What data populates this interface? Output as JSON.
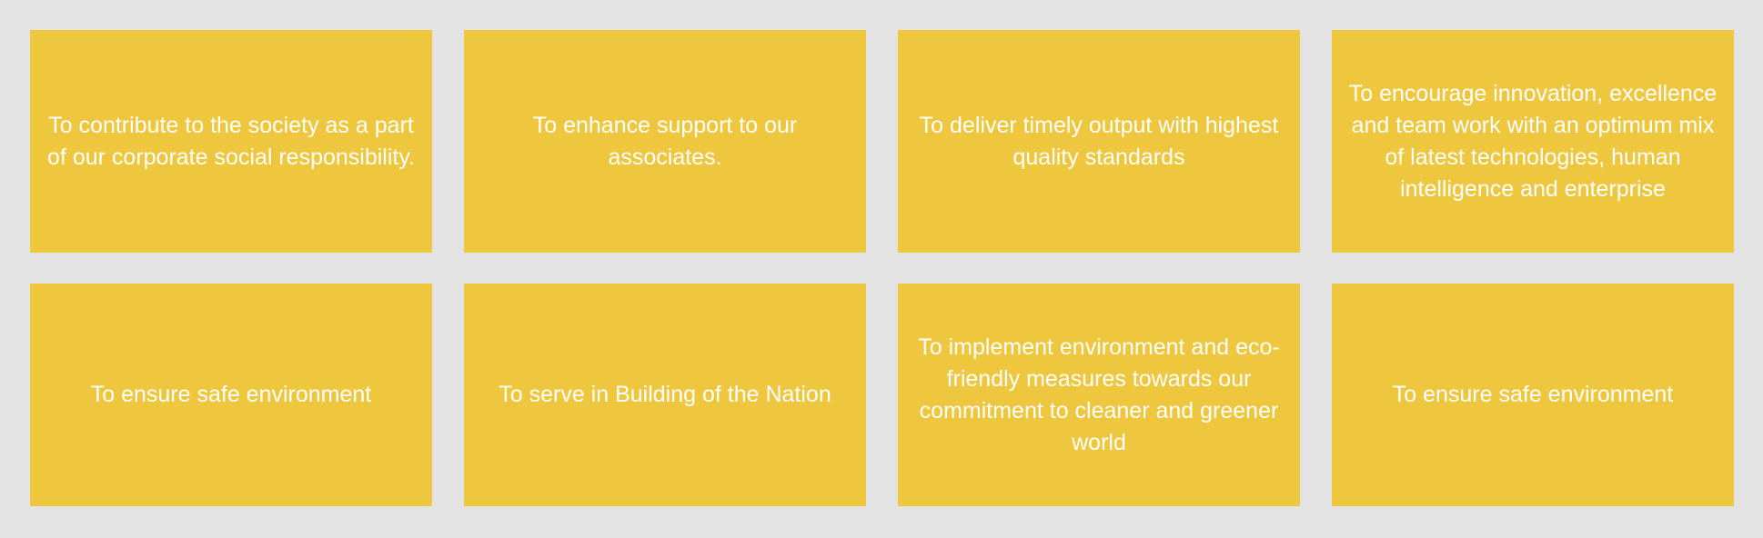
{
  "colors": {
    "background": "#e3e3e3",
    "card": "#efc73f",
    "text": "#ffffff"
  },
  "cards": [
    {
      "text": "To contribute to the society as a part of our corporate social responsibility."
    },
    {
      "text": "To enhance support to our associates."
    },
    {
      "text": "To deliver timely output with highest quality standards"
    },
    {
      "text": "To encourage innovation, excellence and team work with an optimum mix of latest technologies, human intelligence and enterprise"
    },
    {
      "text": "To ensure safe environment"
    },
    {
      "text": "To serve in Building of the Nation"
    },
    {
      "text": "To implement environment and eco-friendly measures towards our commitment to cleaner and greener world"
    },
    {
      "text": "To ensure safe environment"
    }
  ]
}
